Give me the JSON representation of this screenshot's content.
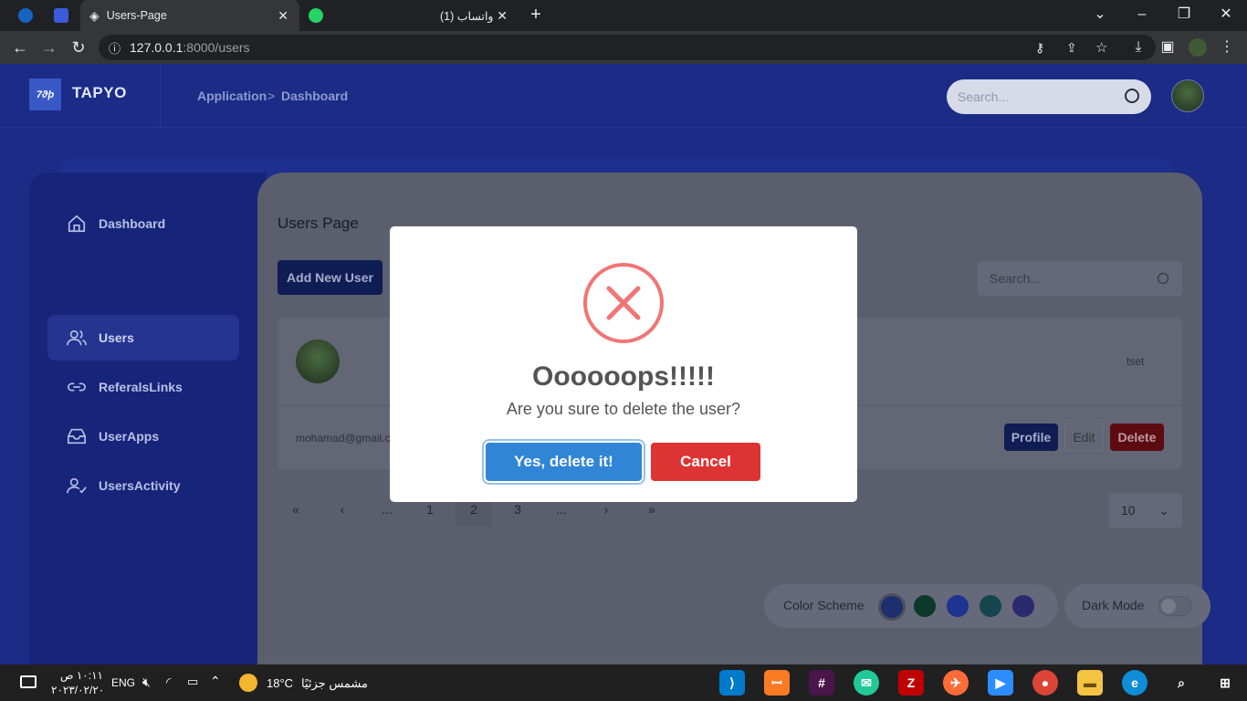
{
  "browser": {
    "tabs": [
      {
        "title": "Users-Page"
      },
      {
        "title": "(1) واتساب"
      }
    ],
    "url_host": "127.0.0.1",
    "url_path": ":8000/users"
  },
  "app": {
    "brand": "TAPYO",
    "logo_text": "7ϑϸ",
    "breadcrumb": [
      "Application",
      ">",
      "Dashboard"
    ],
    "search_placeholder": "Search..."
  },
  "sidebar": {
    "items": [
      {
        "label": "Dashboard",
        "icon": "home-icon"
      },
      {
        "label": "Users",
        "icon": "users-icon",
        "active": true
      },
      {
        "label": "ReferalsLinks",
        "icon": "link-icon"
      },
      {
        "label": "UserApps",
        "icon": "inbox-icon"
      },
      {
        "label": "UsersActivity",
        "icon": "user-check-icon"
      }
    ]
  },
  "main": {
    "title": "Users Page",
    "add_button": "Add New User",
    "search_placeholder": "Search...",
    "user": {
      "tag": "tset",
      "email": "mohamad@gmail.c",
      "profile_label": "Profile",
      "edit_label": "Edit",
      "delete_label": "Delete"
    },
    "pagination": [
      "«",
      "‹",
      "...",
      "1",
      "2",
      "3",
      "...",
      "›",
      "»"
    ],
    "current_page": "2",
    "per_page": "10",
    "color_scheme_label": "Color Scheme",
    "scheme_colors": [
      "#1e2f6e",
      "#0b3a28",
      "#1f3391",
      "#16454f",
      "#2b2a6f"
    ],
    "dark_mode_label": "Dark Mode"
  },
  "modal": {
    "title": "Oooooops!!!!!",
    "text": "Are you sure to delete the user?",
    "confirm_label": "Yes, delete it!",
    "cancel_label": "Cancel"
  },
  "taskbar": {
    "weather_temp": "18°C",
    "weather_text": "مشمس جزئيًا",
    "language": "ENG",
    "time": "١٠:١١ ص",
    "date": "٢٠٢٣/٠٢/٢٠"
  }
}
